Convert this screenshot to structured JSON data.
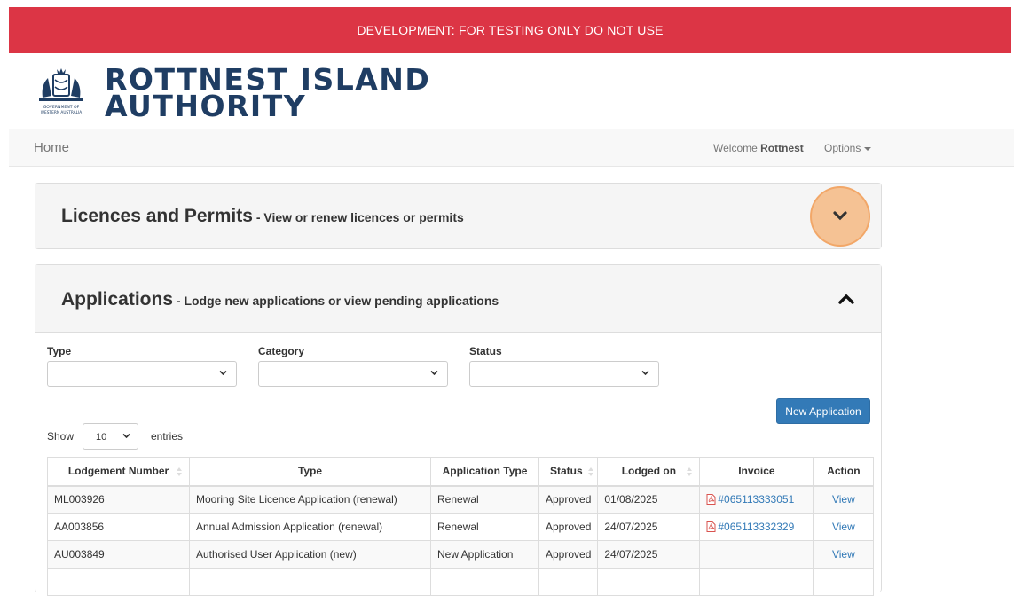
{
  "banner": {
    "text": "DEVELOPMENT: FOR TESTING ONLY DO NOT USE"
  },
  "brand": {
    "line1": "ROTTNEST ISLAND",
    "line2": "AUTHORITY",
    "crest_caption1": "GOVERNMENT OF",
    "crest_caption2": "WESTERN AUSTRALIA"
  },
  "nav": {
    "home": "Home",
    "welcome_prefix": "Welcome ",
    "user": "Rottnest",
    "options": "Options"
  },
  "licences": {
    "title": "Licences and Permits",
    "subtitle": " - View or renew licences or permits"
  },
  "applications": {
    "title": "Applications",
    "subtitle": " - Lodge new applications or view pending applications",
    "filters": {
      "type_label": "Type",
      "category_label": "Category",
      "status_label": "Status"
    },
    "new_button": "New Application",
    "show_label": "Show",
    "entries_value": "10",
    "entries_label": "entries",
    "columns": [
      "Lodgement Number",
      "Type",
      "Application Type",
      "Status",
      "Lodged on",
      "Invoice",
      "Action"
    ],
    "rows": [
      {
        "lodgement": "ML003926",
        "type": "Mooring Site Licence Application (renewal)",
        "app_type": "Renewal",
        "status": "Approved",
        "lodged": "01/08/2025",
        "invoice": "#065113333051",
        "action": "View"
      },
      {
        "lodgement": "AA003856",
        "type": "Annual Admission Application (renewal)",
        "app_type": "Renewal",
        "status": "Approved",
        "lodged": "24/07/2025",
        "invoice": "#065113332329",
        "action": "View"
      },
      {
        "lodgement": "AU003849",
        "type": "Authorised User Application (new)",
        "app_type": "New Application",
        "status": "Approved",
        "lodged": "24/07/2025",
        "invoice": "",
        "action": "View"
      }
    ]
  },
  "colors": {
    "banner": "#dc3545",
    "brand": "#1f3d63",
    "primary": "#337ab7",
    "highlight": "#f5a65f"
  }
}
